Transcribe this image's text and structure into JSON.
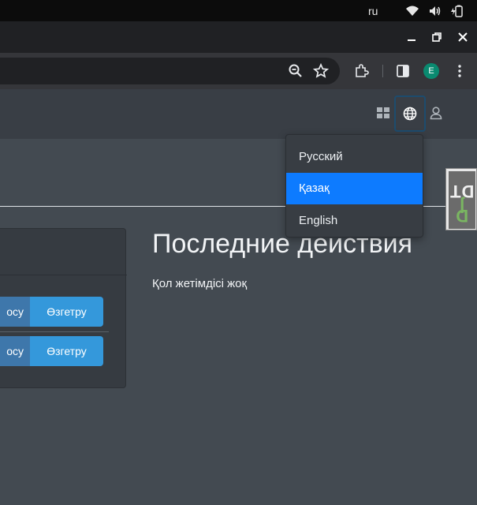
{
  "os": {
    "language": "ru"
  },
  "browser": {
    "profile_initial": "E"
  },
  "dropdown": {
    "items": [
      {
        "label": "Русский",
        "active": false
      },
      {
        "label": "Қазақ",
        "active": true
      },
      {
        "label": "English",
        "active": false
      }
    ]
  },
  "main": {
    "title": "Последние действия",
    "no_access_text": "Қол жетімдісі жоқ"
  },
  "card": {
    "rows": [
      {
        "left_label": "осу",
        "right_label": "Өзгетру"
      },
      {
        "left_label": "осу",
        "right_label": "Өзгетру"
      }
    ]
  },
  "djdt": {
    "first": "D",
    "second": "j",
    "rest": "DT"
  },
  "colors": {
    "accent_blue": "#0d7bff",
    "button_blue": "#3498db",
    "button_dark_blue": "#3e77ab",
    "background": "#434a51"
  }
}
